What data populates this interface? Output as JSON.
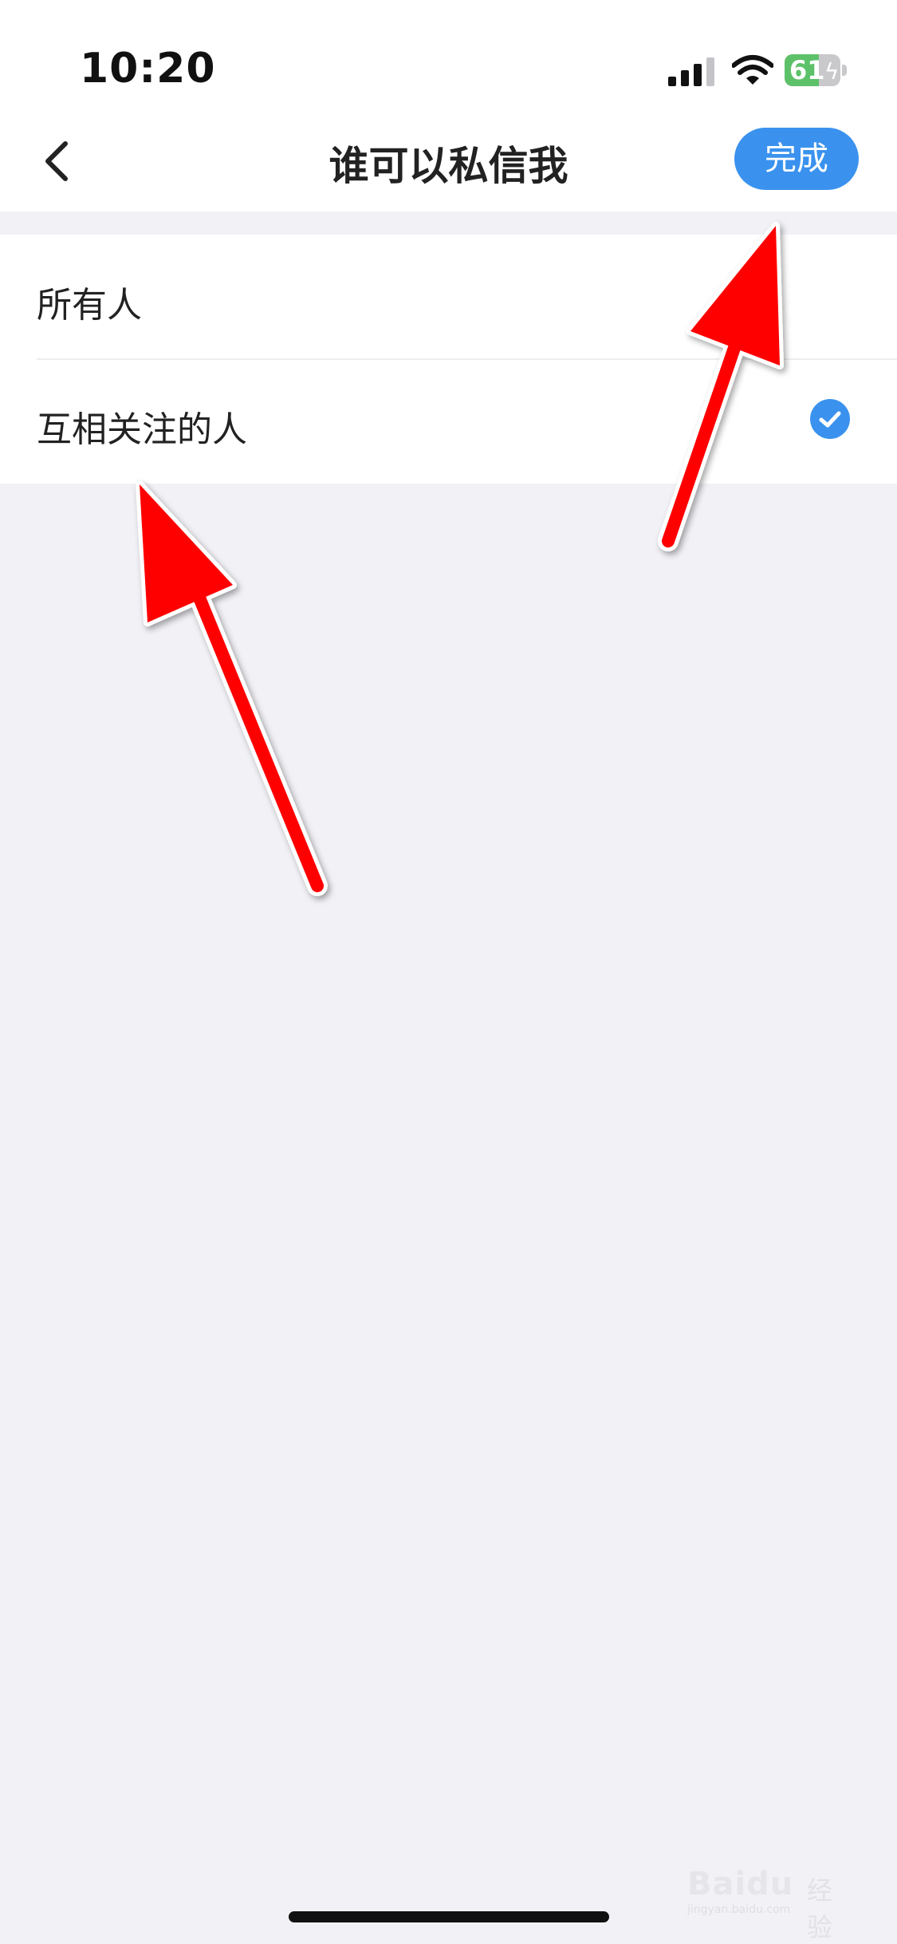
{
  "status_bar": {
    "time": "10:20",
    "battery_percent": "61",
    "battery_level": 0.61,
    "icons": [
      "signal-icon",
      "wifi-icon",
      "battery-charging-icon"
    ]
  },
  "nav": {
    "back_icon": "chevron-left-icon",
    "title": "谁可以私信我",
    "done_label": "完成"
  },
  "options": [
    {
      "label": "所有人",
      "selected": false
    },
    {
      "label": "互相关注的人",
      "selected": true
    }
  ],
  "colors": {
    "accent": "#3a92ee",
    "battery": "#5dc16a",
    "annotation_arrow": "#ff0000",
    "background": "#f1f1f6"
  },
  "watermark": {
    "brand": "Baidu",
    "text": "经验",
    "url": "jingyan.baidu.com"
  }
}
